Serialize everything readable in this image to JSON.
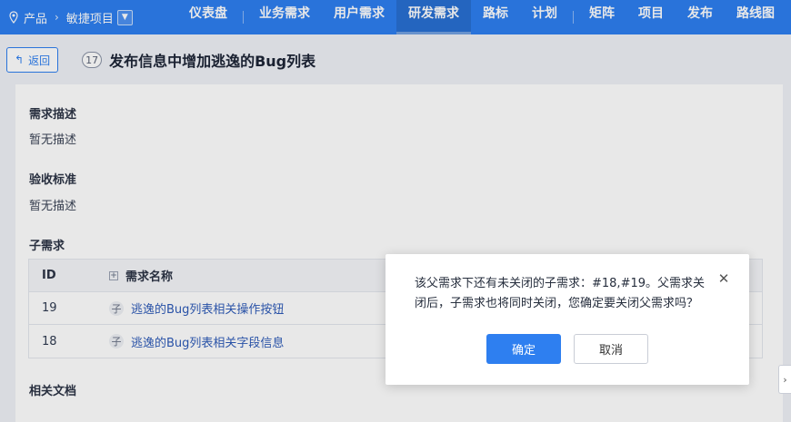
{
  "breadcrumb": {
    "product_label": "产品",
    "separator": "›",
    "project_label": "敏捷项目",
    "dropdown_icon": "chevron-down-icon"
  },
  "nav": {
    "items": [
      {
        "label": "仪表盘"
      },
      {
        "label": "业务需求"
      },
      {
        "label": "用户需求"
      },
      {
        "label": "研发需求",
        "active": true
      },
      {
        "label": "路标"
      },
      {
        "label": "计划"
      },
      {
        "label": "矩阵"
      },
      {
        "label": "项目"
      },
      {
        "label": "发布"
      },
      {
        "label": "路线图"
      }
    ]
  },
  "header": {
    "back_label": "返回",
    "story_id": "17",
    "story_title": "发布信息中增加逃逸的Bug列表"
  },
  "sections": {
    "desc_title": "需求描述",
    "desc_text": "暂无描述",
    "verify_title": "验收标准",
    "verify_text": "暂无描述",
    "children_title": "子需求",
    "docs_title": "相关文档"
  },
  "child_table": {
    "columns": [
      "ID",
      "需求名称"
    ],
    "expand_glyph": "+",
    "rows": [
      {
        "id": "19",
        "type_badge": "子",
        "name": "逃逸的Bug列表相关操作按钮"
      },
      {
        "id": "18",
        "type_badge": "子",
        "name": "逃逸的Bug列表相关字段信息"
      }
    ]
  },
  "dialog": {
    "message": "该父需求下还有未关闭的子需求：#18,#19。父需求关闭后，子需求也将同时关闭，您确定要关闭父需求吗？",
    "confirm_label": "确定",
    "cancel_label": "取消",
    "close_glyph": "✕"
  },
  "side_toggle_glyph": "›",
  "colors": {
    "primary": "#2e7ff0",
    "link": "#2e5bb8"
  }
}
